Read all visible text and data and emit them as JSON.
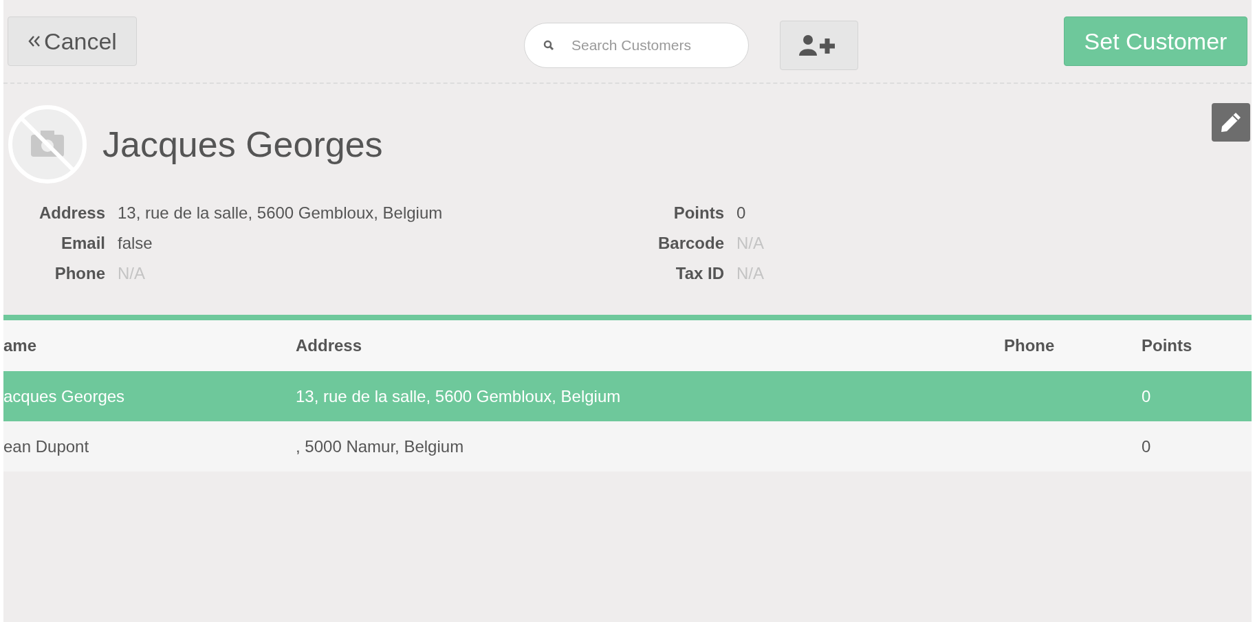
{
  "toolbar": {
    "cancel_button": "Cancel",
    "search": {
      "placeholder": "Search Customers"
    },
    "set_customer_button": "Set Customer"
  },
  "customer": {
    "name": "Jacques Georges",
    "details_left": [
      {
        "label": "Address",
        "value": "13, rue de la salle, 5600 Gembloux, Belgium",
        "empty": false
      },
      {
        "label": "Email",
        "value": "false",
        "empty": false
      },
      {
        "label": "Phone",
        "value": "N/A",
        "empty": true
      }
    ],
    "details_right": [
      {
        "label": "Points",
        "value": "0",
        "empty": false
      },
      {
        "label": "Barcode",
        "value": "N/A",
        "empty": true
      },
      {
        "label": "Tax ID",
        "value": "N/A",
        "empty": true
      }
    ]
  },
  "table": {
    "columns": [
      "ame",
      "Address",
      "Phone",
      "Points"
    ],
    "rows": [
      {
        "cells": [
          "acques Georges",
          "13, rue de la salle, 5600 Gembloux, Belgium",
          "",
          "0"
        ],
        "selected": true
      },
      {
        "cells": [
          "ean Dupont",
          ", 5000 Namur, Belgium",
          "",
          "0"
        ],
        "selected": false
      }
    ]
  }
}
